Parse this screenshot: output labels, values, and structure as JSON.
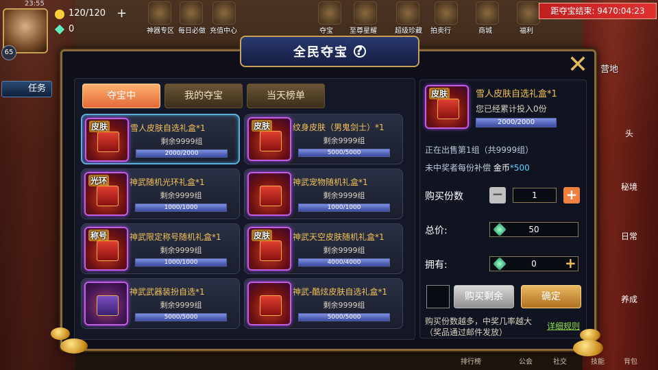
{
  "hud": {
    "time": "23:55",
    "energy": "120/120",
    "gems": "0",
    "level": "65",
    "countdown": "距夺宝结束: 9470:04:23",
    "top_icons": [
      "神器专区",
      "每日必做",
      "充值中心",
      "夺宝",
      "至尊星耀",
      "超级珍藏",
      "拍卖行",
      "商城",
      "福利"
    ],
    "quest_button": "任务",
    "camp": "营地",
    "bottom_nav": [
      "排行榜",
      "公会",
      "社交",
      "技能",
      "背包"
    ],
    "side_right": [
      "头",
      "秘境",
      "日常",
      "养成"
    ]
  },
  "panel": {
    "title": "全民夺宝",
    "help": "?",
    "tabs": [
      "夺宝中",
      "我的夺宝",
      "当天榜单"
    ],
    "items": [
      {
        "tag": "皮肤",
        "name": "雪人皮肤自选礼盒*1",
        "remain": "剩余9999组",
        "progress": "2000/2000",
        "fill": 1.0
      },
      {
        "tag": "皮肤",
        "name": "纹身皮肤（男鬼剑士）*1",
        "remain": "剩余9999组",
        "progress": "5000/5000",
        "fill": 1.0
      },
      {
        "tag": "光环",
        "name": "神武随机光环礼盒*1",
        "remain": "剩余9999组",
        "progress": "1000/1000",
        "fill": 1.0
      },
      {
        "tag": "",
        "name": "神武宠物随机礼盒*1",
        "remain": "剩余9999组",
        "progress": "1000/1000",
        "fill": 1.0
      },
      {
        "tag": "称号",
        "name": "神武限定称号随机礼盒*1",
        "remain": "剩余9999组",
        "progress": "1000/1000",
        "fill": 1.0
      },
      {
        "tag": "皮肤",
        "name": "神武天空皮肤随机礼盒*1",
        "remain": "剩余9999组",
        "progress": "4000/4000",
        "fill": 1.0
      },
      {
        "tag": "",
        "name": "神武武器装扮自选*1",
        "remain": "剩余9999组",
        "progress": "5000/5000",
        "fill": 1.0
      },
      {
        "tag": "",
        "name": "神武-酷炫皮肤自选礼盒*1",
        "remain": "剩余9999组",
        "progress": "5000/5000",
        "fill": 1.0
      }
    ],
    "detail": {
      "tag": "皮肤",
      "name": "雪人皮肤自选礼盒*1",
      "invested": "您已经累计投入0份",
      "progress": "2000/2000",
      "fill": 1.0,
      "selling": "正在出售第1组（共9999组）",
      "compensation_prefix": "未中奖者每份补偿",
      "compensation_label": "金币",
      "compensation_value": "*500",
      "buy_count_label": "购买份数",
      "buy_count": "1",
      "total_label": "总价:",
      "total_value": "50",
      "owned_label": "拥有:",
      "owned_value": "0",
      "buy_rest_button": "购买剩余",
      "confirm_button": "确定",
      "note_line1": "购买份数越多，中奖几率越大",
      "note_line2": "（奖品通过邮件发放）",
      "rules_link": "详细规则"
    },
    "colors": {
      "accent": "#e26a38",
      "gold": "#f2c25a",
      "green": "#8fe04a",
      "border": "#8a6a3a"
    }
  }
}
